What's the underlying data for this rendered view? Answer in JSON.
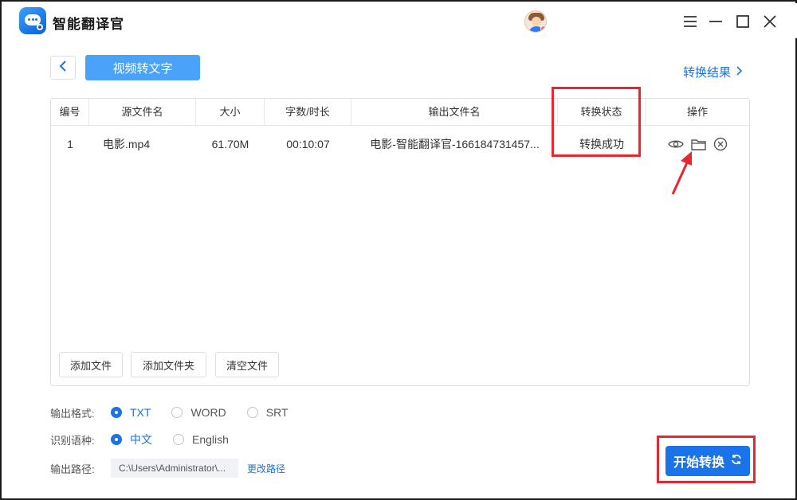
{
  "app": {
    "title": "智能翻译官"
  },
  "toolbar": {
    "mode_tab": "视频转文字",
    "result_link": "转换结果"
  },
  "table": {
    "headers": [
      "编号",
      "源文件名",
      "大小",
      "字数/时长",
      "输出文件名",
      "转换状态",
      "操作"
    ],
    "rows": [
      {
        "index": "1",
        "source": "电影.mp4",
        "size": "61.70M",
        "duration": "00:10:07",
        "output": "电影-智能翻译官-166184731457...",
        "status": "转换成功"
      }
    ]
  },
  "panel_buttons": {
    "add_file": "添加文件",
    "add_folder": "添加文件夹",
    "clear": "清空文件"
  },
  "options": {
    "format_label": "输出格式:",
    "formats": [
      "TXT",
      "WORD",
      "SRT"
    ],
    "selected_format": "TXT",
    "language_label": "识别语种:",
    "languages": [
      "中文",
      "English"
    ],
    "selected_language": "中文",
    "path_label": "输出路径:",
    "path_value": "C:\\Users\\Administrator\\...",
    "change_path": "更改路径"
  },
  "start_button": {
    "label": "开始转换"
  },
  "colors": {
    "accent": "#1a73e8",
    "tab_bg": "#4aa3f8",
    "annotation": "#e8262d"
  },
  "icons": [
    "minimize-icon",
    "restore-icon",
    "close-icon",
    "chevron-left-icon",
    "chevron-right-icon",
    "eye-icon",
    "folder-icon",
    "delete-icon",
    "refresh-icon"
  ]
}
